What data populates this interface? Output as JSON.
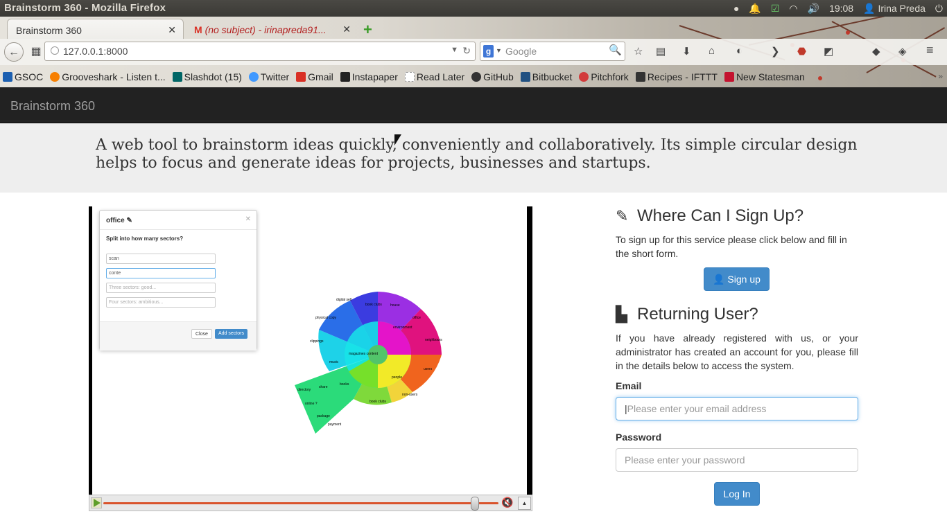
{
  "os": {
    "window_title": "Brainstorm 360 - Mozilla Firefox",
    "clock": "19:08",
    "user": "Irina Preda"
  },
  "browser": {
    "tabs": [
      {
        "label": "Brainstorm 360",
        "active": true
      },
      {
        "label": "(no subject) - irinapreda91...",
        "active": false
      }
    ],
    "url": "127.0.0.1:8000",
    "search_placeholder": "Google",
    "bookmarks": [
      {
        "label": "GSOC",
        "icon": "gsoc-icon",
        "color": "#1c5fb0"
      },
      {
        "label": "Grooveshark - Listen t...",
        "icon": "grooveshark-icon",
        "color": "#f77f00"
      },
      {
        "label": "Slashdot (15)",
        "icon": "slashdot-icon",
        "color": "#006666"
      },
      {
        "label": "Twitter",
        "icon": "twitter-icon",
        "color": "#4099ff"
      },
      {
        "label": "Gmail",
        "icon": "gmail-icon",
        "color": "#d93025"
      },
      {
        "label": "Instapaper",
        "icon": "instapaper-icon",
        "color": "#222222"
      },
      {
        "label": "Read Later",
        "icon": "read-later-icon",
        "color": "#999999"
      },
      {
        "label": "GitHub",
        "icon": "github-icon",
        "color": "#333333"
      },
      {
        "label": "Bitbucket",
        "icon": "bitbucket-icon",
        "color": "#205081"
      },
      {
        "label": "Pitchfork",
        "icon": "pitchfork-icon",
        "color": "#d23b3b"
      },
      {
        "label": "Recipes - IFTTT",
        "icon": "ifttt-icon",
        "color": "#333333"
      },
      {
        "label": "New Statesman",
        "icon": "new-statesman-icon",
        "color": "#c4122f"
      }
    ]
  },
  "app": {
    "brand": "Brainstorm 360",
    "tagline": "A web tool to brainstorm ideas quickly, conveniently and collaboratively. Its simple circular design helps to focus and generate ideas for projects, businesses and startups."
  },
  "video": {
    "modal": {
      "title": "office",
      "question": "Split into how many sectors?",
      "inputs": [
        "scan",
        "conte"
      ],
      "placeholders": [
        "Three sectors: good...",
        "Four sectors: ambitious..."
      ],
      "close_label": "Close",
      "add_label": "Add sectors"
    },
    "wheel_labels": [
      "music",
      "clippings",
      "magazines content",
      "books",
      "share",
      "directory",
      "online ?",
      "package",
      "people",
      "book clubs",
      "non-users",
      "users",
      "neighbours",
      "office",
      "house",
      "environment",
      "book clubs",
      "digital sell",
      "physical copy",
      "payment"
    ],
    "progress": 0.95
  },
  "signup": {
    "heading": "Where Can I Sign Up?",
    "text": "To sign up for this service please click below and fill in the short form.",
    "button": "Sign up"
  },
  "login": {
    "heading": "Returning User?",
    "text": "If you have already registered with us, or your administrator has created an account for you, please fill in the details below to access the system.",
    "email_label": "Email",
    "email_placeholder": "Please enter your email address",
    "password_label": "Password",
    "password_placeholder": "Please enter your password",
    "button": "Log In"
  },
  "colors": {
    "accent": "#428bca",
    "navbar": "#222222",
    "jumbotron": "#eeeeee"
  }
}
